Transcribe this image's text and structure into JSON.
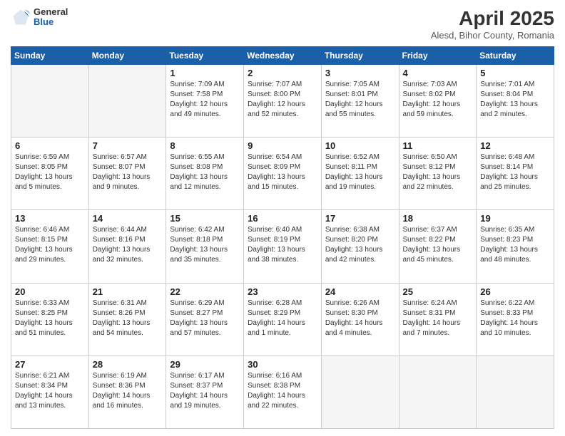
{
  "header": {
    "logo": {
      "general": "General",
      "blue": "Blue"
    },
    "title": "April 2025",
    "location": "Alesd, Bihor County, Romania"
  },
  "columns": [
    "Sunday",
    "Monday",
    "Tuesday",
    "Wednesday",
    "Thursday",
    "Friday",
    "Saturday"
  ],
  "weeks": [
    [
      {
        "day": "",
        "info": ""
      },
      {
        "day": "",
        "info": ""
      },
      {
        "day": "1",
        "info": "Sunrise: 7:09 AM\nSunset: 7:58 PM\nDaylight: 12 hours and 49 minutes."
      },
      {
        "day": "2",
        "info": "Sunrise: 7:07 AM\nSunset: 8:00 PM\nDaylight: 12 hours and 52 minutes."
      },
      {
        "day": "3",
        "info": "Sunrise: 7:05 AM\nSunset: 8:01 PM\nDaylight: 12 hours and 55 minutes."
      },
      {
        "day": "4",
        "info": "Sunrise: 7:03 AM\nSunset: 8:02 PM\nDaylight: 12 hours and 59 minutes."
      },
      {
        "day": "5",
        "info": "Sunrise: 7:01 AM\nSunset: 8:04 PM\nDaylight: 13 hours and 2 minutes."
      }
    ],
    [
      {
        "day": "6",
        "info": "Sunrise: 6:59 AM\nSunset: 8:05 PM\nDaylight: 13 hours and 5 minutes."
      },
      {
        "day": "7",
        "info": "Sunrise: 6:57 AM\nSunset: 8:07 PM\nDaylight: 13 hours and 9 minutes."
      },
      {
        "day": "8",
        "info": "Sunrise: 6:55 AM\nSunset: 8:08 PM\nDaylight: 13 hours and 12 minutes."
      },
      {
        "day": "9",
        "info": "Sunrise: 6:54 AM\nSunset: 8:09 PM\nDaylight: 13 hours and 15 minutes."
      },
      {
        "day": "10",
        "info": "Sunrise: 6:52 AM\nSunset: 8:11 PM\nDaylight: 13 hours and 19 minutes."
      },
      {
        "day": "11",
        "info": "Sunrise: 6:50 AM\nSunset: 8:12 PM\nDaylight: 13 hours and 22 minutes."
      },
      {
        "day": "12",
        "info": "Sunrise: 6:48 AM\nSunset: 8:14 PM\nDaylight: 13 hours and 25 minutes."
      }
    ],
    [
      {
        "day": "13",
        "info": "Sunrise: 6:46 AM\nSunset: 8:15 PM\nDaylight: 13 hours and 29 minutes."
      },
      {
        "day": "14",
        "info": "Sunrise: 6:44 AM\nSunset: 8:16 PM\nDaylight: 13 hours and 32 minutes."
      },
      {
        "day": "15",
        "info": "Sunrise: 6:42 AM\nSunset: 8:18 PM\nDaylight: 13 hours and 35 minutes."
      },
      {
        "day": "16",
        "info": "Sunrise: 6:40 AM\nSunset: 8:19 PM\nDaylight: 13 hours and 38 minutes."
      },
      {
        "day": "17",
        "info": "Sunrise: 6:38 AM\nSunset: 8:20 PM\nDaylight: 13 hours and 42 minutes."
      },
      {
        "day": "18",
        "info": "Sunrise: 6:37 AM\nSunset: 8:22 PM\nDaylight: 13 hours and 45 minutes."
      },
      {
        "day": "19",
        "info": "Sunrise: 6:35 AM\nSunset: 8:23 PM\nDaylight: 13 hours and 48 minutes."
      }
    ],
    [
      {
        "day": "20",
        "info": "Sunrise: 6:33 AM\nSunset: 8:25 PM\nDaylight: 13 hours and 51 minutes."
      },
      {
        "day": "21",
        "info": "Sunrise: 6:31 AM\nSunset: 8:26 PM\nDaylight: 13 hours and 54 minutes."
      },
      {
        "day": "22",
        "info": "Sunrise: 6:29 AM\nSunset: 8:27 PM\nDaylight: 13 hours and 57 minutes."
      },
      {
        "day": "23",
        "info": "Sunrise: 6:28 AM\nSunset: 8:29 PM\nDaylight: 14 hours and 1 minute."
      },
      {
        "day": "24",
        "info": "Sunrise: 6:26 AM\nSunset: 8:30 PM\nDaylight: 14 hours and 4 minutes."
      },
      {
        "day": "25",
        "info": "Sunrise: 6:24 AM\nSunset: 8:31 PM\nDaylight: 14 hours and 7 minutes."
      },
      {
        "day": "26",
        "info": "Sunrise: 6:22 AM\nSunset: 8:33 PM\nDaylight: 14 hours and 10 minutes."
      }
    ],
    [
      {
        "day": "27",
        "info": "Sunrise: 6:21 AM\nSunset: 8:34 PM\nDaylight: 14 hours and 13 minutes."
      },
      {
        "day": "28",
        "info": "Sunrise: 6:19 AM\nSunset: 8:36 PM\nDaylight: 14 hours and 16 minutes."
      },
      {
        "day": "29",
        "info": "Sunrise: 6:17 AM\nSunset: 8:37 PM\nDaylight: 14 hours and 19 minutes."
      },
      {
        "day": "30",
        "info": "Sunrise: 6:16 AM\nSunset: 8:38 PM\nDaylight: 14 hours and 22 minutes."
      },
      {
        "day": "",
        "info": ""
      },
      {
        "day": "",
        "info": ""
      },
      {
        "day": "",
        "info": ""
      }
    ]
  ]
}
